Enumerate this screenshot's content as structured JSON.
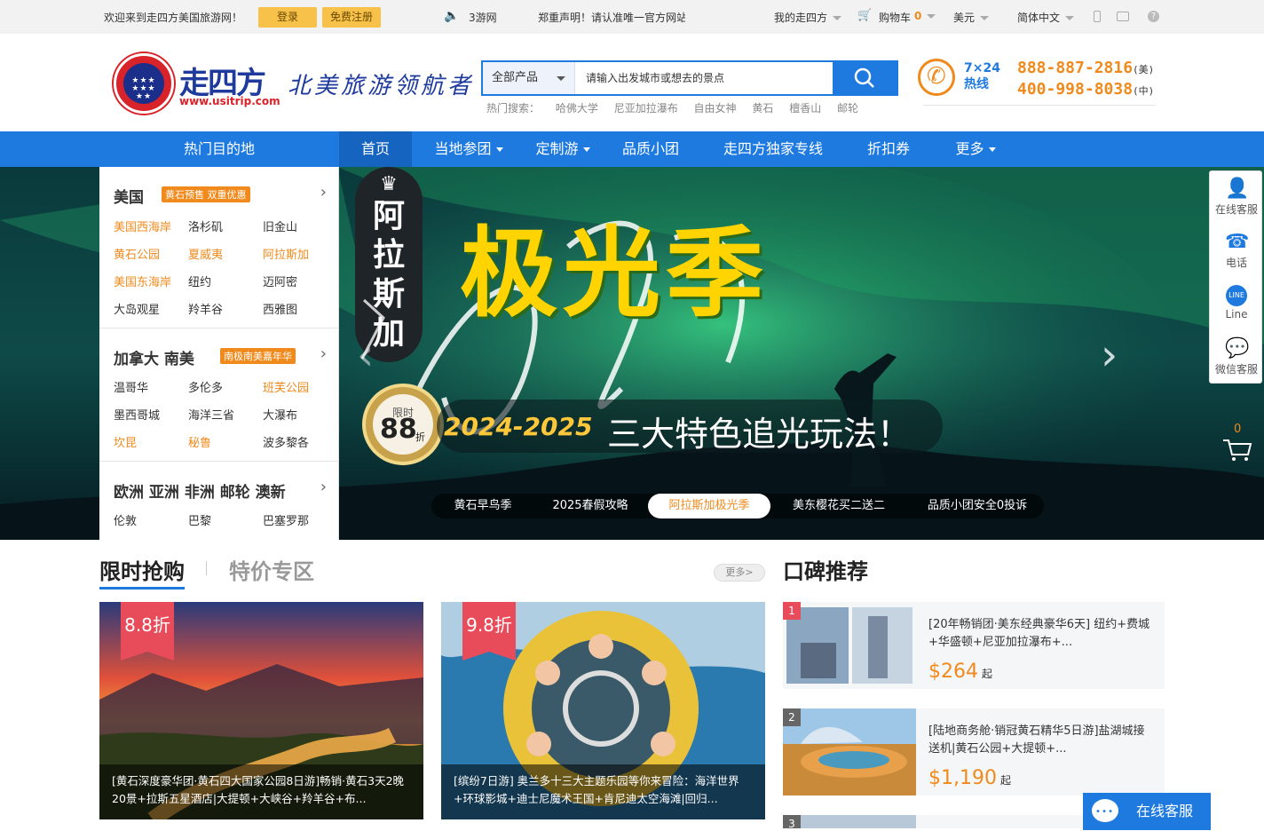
{
  "topbar": {
    "welcome": "欢迎来到走四方美国旅游网！",
    "login": "登录",
    "register": "免费注册",
    "sound_text": "3游网",
    "notice": "郑重声明！请认准唯一官方网站",
    "my_account": "我的走四方",
    "cart_label": "购物车",
    "cart_count": "0",
    "currency": "美元",
    "language": "简体中文"
  },
  "header": {
    "logo_cn": "走四方",
    "logo_url": "www.usitrip.com",
    "logo_ring_text": "UNITEDSTARS INTERNATIONAL",
    "slogan": "北美旅游领航者",
    "search": {
      "category": "全部产品",
      "placeholder": "请输入出发城市或想去的景点"
    },
    "hot_search": {
      "label": "热门搜索：",
      "items": [
        "哈佛大学",
        "尼亚加拉瀑布",
        "自由女神",
        "黄石",
        "檀香山",
        "邮轮"
      ]
    },
    "hotline": {
      "label_top": "7×24",
      "label_bottom": "热线",
      "us_number": "888-887-2816",
      "us_tag": "(美)",
      "cn_number": "400-998-8038",
      "cn_tag": "(中)"
    }
  },
  "nav": {
    "destinations": "热门目的地",
    "items": [
      "首页",
      "当地参团",
      "定制游",
      "品质小团",
      "走四方独家专线",
      "折扣券",
      "更多"
    ]
  },
  "sidemenu": {
    "usa": {
      "title": "美国",
      "tag": "黄石预售 双重优惠",
      "cities": [
        "美国西海岸",
        "洛杉矶",
        "旧金山",
        "黄石公园",
        "夏威夷",
        "阿拉斯加",
        "美国东海岸",
        "纽约",
        "迈阿密",
        "大岛观星",
        "羚羊谷",
        "西雅图"
      ]
    },
    "canada": {
      "title": "加拿大  南美",
      "tag": "南极南美嘉年华",
      "cities": [
        "温哥华",
        "多伦多",
        "班芙公园",
        "墨西哥城",
        "海洋三省",
        "大瀑布",
        "坎昆",
        "秘鲁",
        "波多黎各"
      ]
    },
    "others": {
      "title": "欧洲  亚洲  非洲  邮轮  澳新",
      "cities": [
        "伦敦",
        "巴黎",
        "巴塞罗那"
      ]
    }
  },
  "banner": {
    "vertical_title": "阿拉斯加",
    "main_title": "极光季",
    "badge_top": "限时",
    "badge_num": "88",
    "badge_unit": "折",
    "years": "2024-2025",
    "subtitle": "三大特色追光玩法！",
    "dots": [
      "黄石早鸟季",
      "2025春假攻略",
      "阿拉斯加极光季",
      "美东樱花买二送二",
      "品质小团安全0投诉"
    ]
  },
  "right_tools": [
    "在线客服",
    "电话",
    "Line",
    "微信客服"
  ],
  "cart_float_count": "0",
  "flash": {
    "title_active": "限时抢购",
    "title_other": "特价专区",
    "more": "更多>",
    "cards": [
      {
        "discount": "8.8折",
        "caption": "[黄石深度豪华团·黄石四大国家公园8日游]畅销·黄石3天2晚20景+拉斯五星酒店|大提顿+大峡谷+羚羊谷+布..."
      },
      {
        "discount": "9.8折",
        "caption": "[缤纷7日游] 奥兰多十三大主题乐园等你来冒险：海洋世界+环球影城+迪士尼魔术王国+肯尼迪太空海滩|回归..."
      }
    ]
  },
  "recommend": {
    "title": "口碑推荐",
    "items": [
      {
        "rank": "1",
        "title": "[20年畅销团·美东经典豪华6天] 纽约+费城+华盛顿+尼亚加拉瀑布+...",
        "price": "$264",
        "unit": "起"
      },
      {
        "rank": "2",
        "title": "[陆地商务舱·销冠黄石精华5日游]盐湖城接送机|黄石公园+大提顿+...",
        "price": "$1,190",
        "unit": "起"
      },
      {
        "rank": "3",
        "title": "",
        "price": "",
        "unit": ""
      }
    ]
  },
  "chat_float": "在线客服",
  "colors": {
    "brand_blue": "#1f7ae0",
    "accent_orange": "#f08a1c",
    "discount_red": "#e84c5a"
  }
}
